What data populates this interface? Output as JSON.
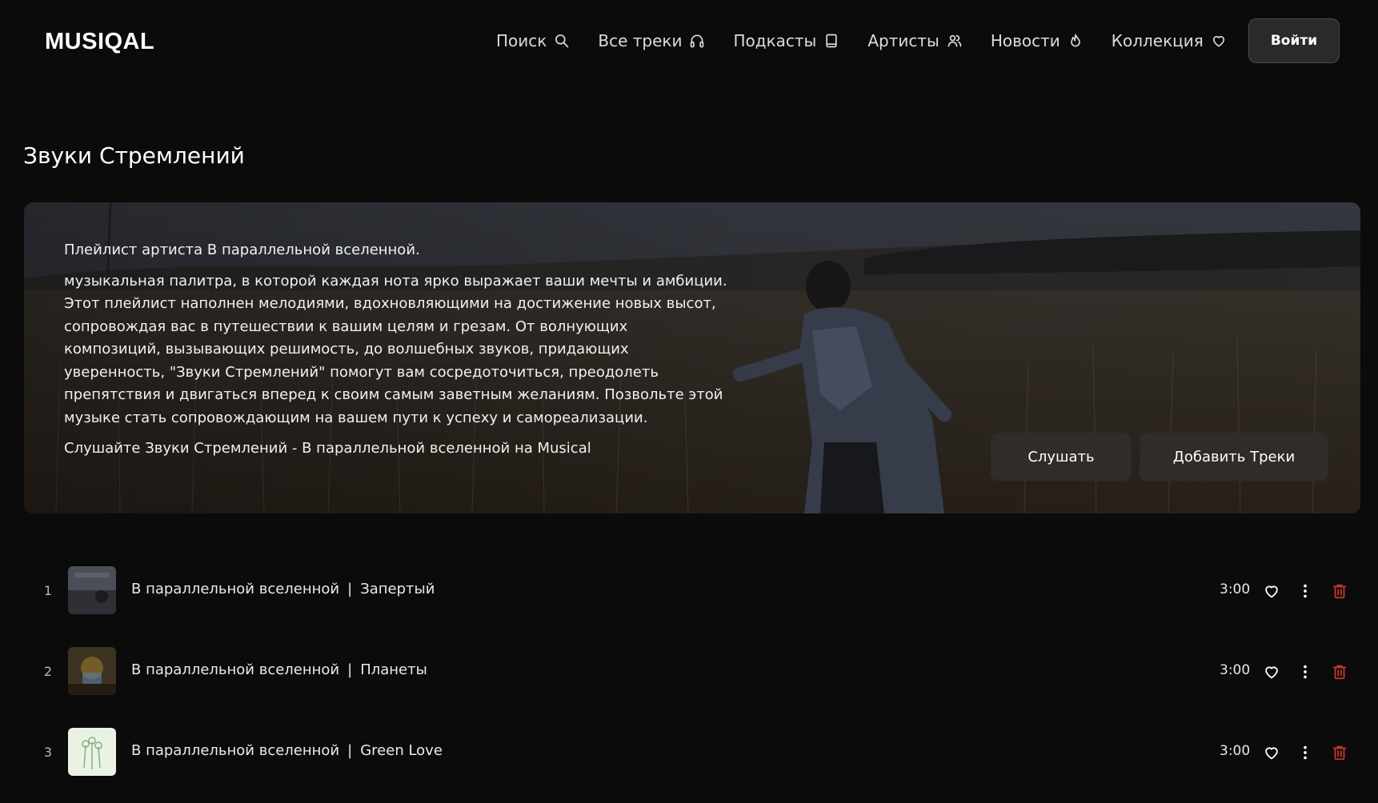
{
  "header": {
    "logo": "MUSIQAL",
    "nav": [
      {
        "label": "Поиск",
        "icon": "search-icon"
      },
      {
        "label": "Все треки",
        "icon": "headphones-icon"
      },
      {
        "label": "Подкасты",
        "icon": "book-icon"
      },
      {
        "label": "Артисты",
        "icon": "users-icon"
      },
      {
        "label": "Новости",
        "icon": "flame-icon"
      },
      {
        "label": "Коллекция",
        "icon": "heart-icon"
      }
    ],
    "login_label": "Войти"
  },
  "page": {
    "title": "Звуки Стремлений"
  },
  "banner": {
    "intro": "Плейлист артиста В параллельной вселенной.",
    "description": "музыкальная палитра, в которой каждая нота ярко выражает ваши мечты и амбиции. Этот плейлист наполнен мелодиями, вдохновляющими на достижение новых высот, сопровождая вас в путешествии к вашим целям и грезам. От волнующих композиций, вызывающих решимость, до волшебных звуков, придающих уверенность, \"Звуки Стремлений\" помогут вам сосредоточиться, преодолеть препятствия и двигаться вперед к своим самым заветным желаниям. Позвольте этой музыке стать сопровождающим на вашем пути к успеху и самореализации.",
    "cta_text": "Слушайте Звуки Стремлений - В параллельной вселенной на Musical",
    "listen_label": "Слушать",
    "add_label": "Добавить Треки"
  },
  "tracks": [
    {
      "number": "1",
      "artist": "В параллельной вселенной",
      "separator": "|",
      "title": "Запертый",
      "duration": "3:00"
    },
    {
      "number": "2",
      "artist": "В параллельной вселенной",
      "separator": "|",
      "title": "Планеты",
      "duration": "3:00"
    },
    {
      "number": "3",
      "artist": "В параллельной вселенной",
      "separator": "|",
      "title": "Green Love",
      "duration": "3:00"
    }
  ],
  "colors": {
    "background": "#0b0b0b",
    "delete_icon": "#c0392b",
    "button_bg": "#2a2a2a"
  }
}
